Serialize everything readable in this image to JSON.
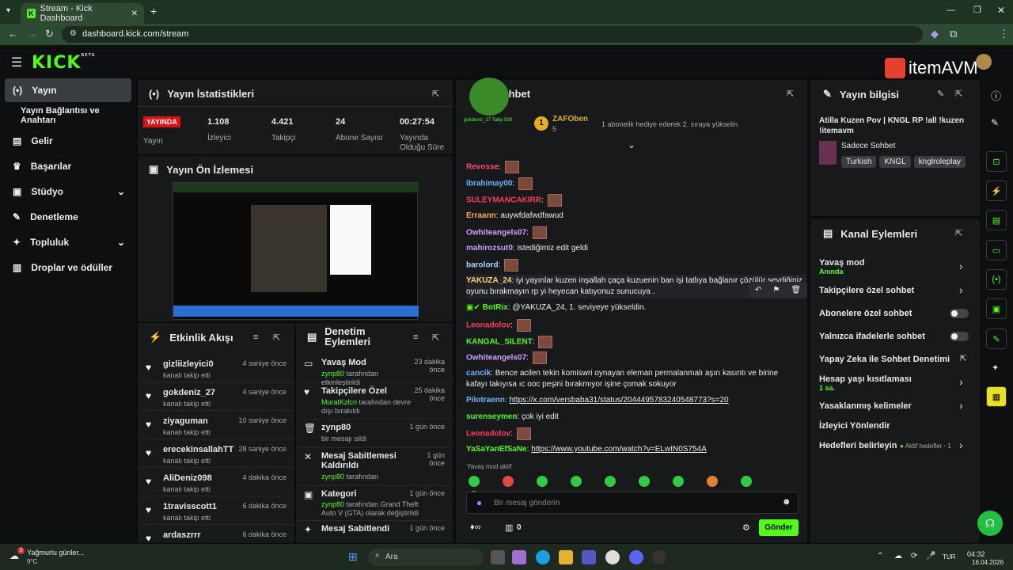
{
  "browser": {
    "tab_title": "Stream - Kick Dashboard",
    "url": "dashboard.kick.com/stream",
    "profile_initial": "M"
  },
  "brand": {
    "logo": "KICK",
    "logo_sup": "BETA",
    "watermark": "itemAVM"
  },
  "sidebar": {
    "items": [
      {
        "label": "Yayın",
        "icon": "broadcast-icon"
      },
      {
        "label": "Yayın Bağlantısı ve Anahtarı",
        "icon": ""
      },
      {
        "label": "Gelir",
        "icon": "chart-icon"
      },
      {
        "label": "Başarılar",
        "icon": "trophy-icon"
      },
      {
        "label": "Stüdyo",
        "icon": "studio-icon"
      },
      {
        "label": "Denetleme",
        "icon": "wrench-icon"
      },
      {
        "label": "Topluluk",
        "icon": "community-icon"
      },
      {
        "label": "Droplar ve ödüller",
        "icon": "gift-icon"
      }
    ]
  },
  "stats": {
    "title": "Yayın İstatistikleri",
    "live": "YAYINDA",
    "live_label": "Yayın",
    "items": [
      {
        "value": "1.108",
        "label": "İzleyici"
      },
      {
        "value": "4.421",
        "label": "Takipçi"
      },
      {
        "value": "24",
        "label": "Abone Sayısı"
      },
      {
        "value": "00:27:54",
        "label": "Yayında Olduğu Süre"
      }
    ]
  },
  "preview": {
    "title": "Yayın Ön İzlemesi"
  },
  "activity": {
    "title": "Etkinlik Akışı",
    "items": [
      {
        "name": "gizliizleyici0",
        "sub": "kanalı takip etti",
        "time": "4 saniye önce"
      },
      {
        "name": "gokdeniz_27",
        "sub": "kanalı takip etti",
        "time": "4 saniye önce"
      },
      {
        "name": "ziyaguman",
        "sub": "kanalı takip etti",
        "time": "10 saniye önce"
      },
      {
        "name": "erecekinsallahTT",
        "sub": "kanalı takip etti",
        "time": "28 saniye önce"
      },
      {
        "name": "AliDeniz098",
        "sub": "kanalı takip etti",
        "time": "4 dakika önce"
      },
      {
        "name": "1travisscott1",
        "sub": "kanalı takip etti",
        "time": "6 dakika önce"
      },
      {
        "name": "ardaszrrr",
        "sub": "",
        "time": "6 dakika önce"
      }
    ]
  },
  "moderation": {
    "title": "Denetim Eylemleri",
    "items": [
      {
        "name": "Yavaş Mod",
        "user": "zynp80",
        "sub": " tarafından etkinleştirildi",
        "time": "23 dakika önce"
      },
      {
        "name": "Takipçilere Özel",
        "user": "MuratKzlcn",
        "sub": " tarafından devre dışı bırakıldı",
        "time": "25 dakika önce"
      },
      {
        "name": "zynp80",
        "user": "",
        "sub": "bir mesajı sildi",
        "time": "1 gün önce"
      },
      {
        "name": "Mesaj Sabitlemesi Kaldırıldı",
        "user": "zynp80",
        "sub": " tarafından",
        "time": "1 gün önce"
      },
      {
        "name": "Kategori",
        "user": "zynp80",
        "sub": " tarafından Grand Theft Auto V (GTA) olarak değiştirildi",
        "time": "1 gün önce"
      },
      {
        "name": "Mesaj Sabitlendi",
        "user": "",
        "sub": "",
        "time": "1 gün önce"
      }
    ]
  },
  "chat": {
    "title": "Sohbet",
    "overlay_text": "gokdeniz_27 Takip Etti!",
    "top_user": "ZAFOben",
    "top_count": "5",
    "gift_text": "1 abonelik hediye ederek 2. sıraya yükselin",
    "messages": [
      {
        "user": "Revosse",
        "color": "#ff4d6d",
        "text": "",
        "emote": true
      },
      {
        "user": "ibrahimay00",
        "color": "#6cb4ff",
        "text": "",
        "emote": true
      },
      {
        "user": "SULEYMANCAKIRR",
        "color": "#ff3b5c",
        "text": "",
        "emote": true
      },
      {
        "user": "Erraann",
        "color": "#ffa94d",
        "text": "auywfdafwdfawud",
        "emote": false
      },
      {
        "user": "Owhiteangels07",
        "color": "#d0a0ff",
        "text": "",
        "emote": true
      },
      {
        "user": "mahirozsut0",
        "color": "#c6a0ff",
        "text": "istediğimiz edit geldi",
        "emote": false
      },
      {
        "user": "barolord",
        "color": "#b0d0ff",
        "text": "",
        "emote": true
      },
      {
        "user": "YAKUZA_24",
        "color": "#ffd27a",
        "text": "iyi yayınlar kuzen inşallah çaça kuzuenin ban işi tatlıya bağlanır çözülür sevdiğiniz oyunu bırakmayın rp yi heyecan katıyonuz sunucuya .",
        "emote": false
      },
      {
        "user": "BotRix",
        "color": "#53fc18",
        "text": "@YAKUZA_24, 1. seviyeye yükseldin.",
        "emote": false
      },
      {
        "user": "Leonadolov",
        "color": "#ff3b5c",
        "text": "",
        "emote": true
      },
      {
        "user": "KANGAL_SILENT",
        "color": "#53fc18",
        "text": "",
        "emote": true
      },
      {
        "user": "Owhiteangels07",
        "color": "#d0a0ff",
        "text": "",
        "emote": true
      },
      {
        "user": "cancik",
        "color": "#6cb4ff",
        "text": "Bence acilen tekin komiswri oynayan eleman permalanmalı aşırı kasıntı ve birine kafayı takıyısa ıc ooc peşini bırakmıyor işine çomak sokuyor",
        "emote": false
      },
      {
        "user": "Pilotraenn",
        "color": "#6cb4ff",
        "text": "https://x.com/versbaba31/status/2044495783240548773?s=20",
        "emote": false
      },
      {
        "user": "surenseymen",
        "color": "#53fc18",
        "text": "çok iyi edit",
        "emote": false
      },
      {
        "user": "Leonadolov",
        "color": "#ff3b5c",
        "text": "",
        "emote": true
      },
      {
        "user": "YaSaYanEfSaNe",
        "color": "#53fc18",
        "text": "https://www.youtube.com/watch?v=ELwIN0S754A",
        "emote": false
      }
    ],
    "slow_mode": "Yavaş mod aktif",
    "placeholder": "Bir mesaj gönderin",
    "points": "0",
    "send": "Gönder"
  },
  "info": {
    "title": "Yayın bilgisi",
    "stream_title": "Atilla Kuzen Pov | KNGL RP !all !kuzen !itemavm",
    "category": "Sadece Sohbet",
    "tags": [
      "Turkish",
      "KNGL",
      "knglroleplay"
    ]
  },
  "channel": {
    "title": "Kanal Eylemleri",
    "items": [
      {
        "label": "Yavaş mod",
        "sub": "Anında",
        "ctrl": "chev"
      },
      {
        "label": "Takipçilere özel sohbet",
        "sub": "",
        "ctrl": "chev"
      },
      {
        "label": "Abonelere özel sohbet",
        "sub": "",
        "ctrl": "toggle"
      },
      {
        "label": "Yalnızca ifadelerle sohbet",
        "sub": "",
        "ctrl": "toggle"
      },
      {
        "label": "Yapay Zeka ile Sohbet Denetimi",
        "sub": "",
        "ctrl": "ext"
      },
      {
        "label": "Hesap yaşı kısıtlaması",
        "sub": "1 sa.",
        "ctrl": "chev"
      },
      {
        "label": "Yasaklanmış kelimeler",
        "sub": "",
        "ctrl": "chev"
      },
      {
        "label": "İzleyici Yönlendir",
        "sub": "",
        "ctrl": "none"
      },
      {
        "label": "Hedefleri belirleyin",
        "sub": "",
        "ctrl": "chev"
      }
    ],
    "goals_status": "Aktif hedefler - 1"
  },
  "taskbar": {
    "weather": "Yağmurlu günler...",
    "temp": "9°C",
    "search": "Ara",
    "time": "04:32",
    "date": "16.04.2026",
    "lang": "TUR",
    "weather_badge": "3"
  }
}
